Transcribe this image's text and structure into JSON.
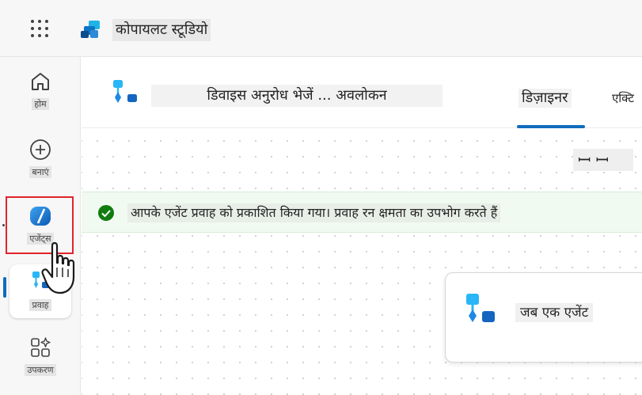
{
  "app": {
    "title": "कोपायलट स्टूडियो"
  },
  "rail": {
    "items": [
      {
        "label": "होम",
        "icon": "home-icon"
      },
      {
        "label": "बनाएं",
        "icon": "create-icon"
      },
      {
        "label": "एजेंट्स",
        "icon": "agents-icon"
      },
      {
        "label": "प्रवाह",
        "icon": "flows-icon"
      },
      {
        "label": "उपकरण",
        "icon": "tools-icon"
      }
    ]
  },
  "flow_header": {
    "title": "डिवाइस अनुरोध भेजें ... अवलोकन",
    "tabs": [
      {
        "label": "डिज़ाइनर",
        "active": true
      },
      {
        "label": "एक्टि"
      }
    ]
  },
  "canvas": {
    "sidebar_toggle_text": "ꟷ ꟷ"
  },
  "banner": {
    "text": "आपके एजेंट प्रवाह को प्रकाशित किया गया। प्रवाह रन क्षमता का उपभोग करते हैं"
  },
  "node": {
    "label": "जब एक एजेंट"
  },
  "colors": {
    "accent": "#0f6cbd",
    "success": "#107c10",
    "highlight_outline": "#e0242b"
  }
}
